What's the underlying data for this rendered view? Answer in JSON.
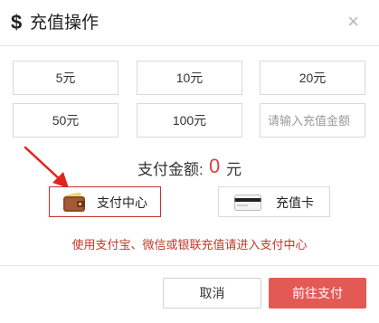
{
  "dialog": {
    "title_icon": "$",
    "title": "充值操作",
    "close_glyph": "×"
  },
  "amounts": {
    "items": [
      "5元",
      "10元",
      "20元",
      "50元",
      "100元"
    ],
    "custom_placeholder": "请输入充值金额"
  },
  "payment": {
    "label": "支付金额:",
    "value": "0",
    "unit": "元"
  },
  "methods": {
    "wallet_label": "支付中心",
    "card_label": "充值卡",
    "selected": "wallet"
  },
  "notice": "使用支付宝、微信或银联充值请进入支付中心",
  "footer": {
    "cancel_label": "取消",
    "confirm_label": "前往支付"
  },
  "colors": {
    "accent": "#e35a55",
    "selected_border": "#c9302c",
    "notice": "#c0392b",
    "amount_value": "#d9403f",
    "arrow": "#e0231d"
  },
  "icons": {
    "wallet": "wallet-icon",
    "card": "card-icon",
    "close": "close-icon",
    "dollar": "dollar-icon",
    "arrow": "arrow-annotation"
  }
}
